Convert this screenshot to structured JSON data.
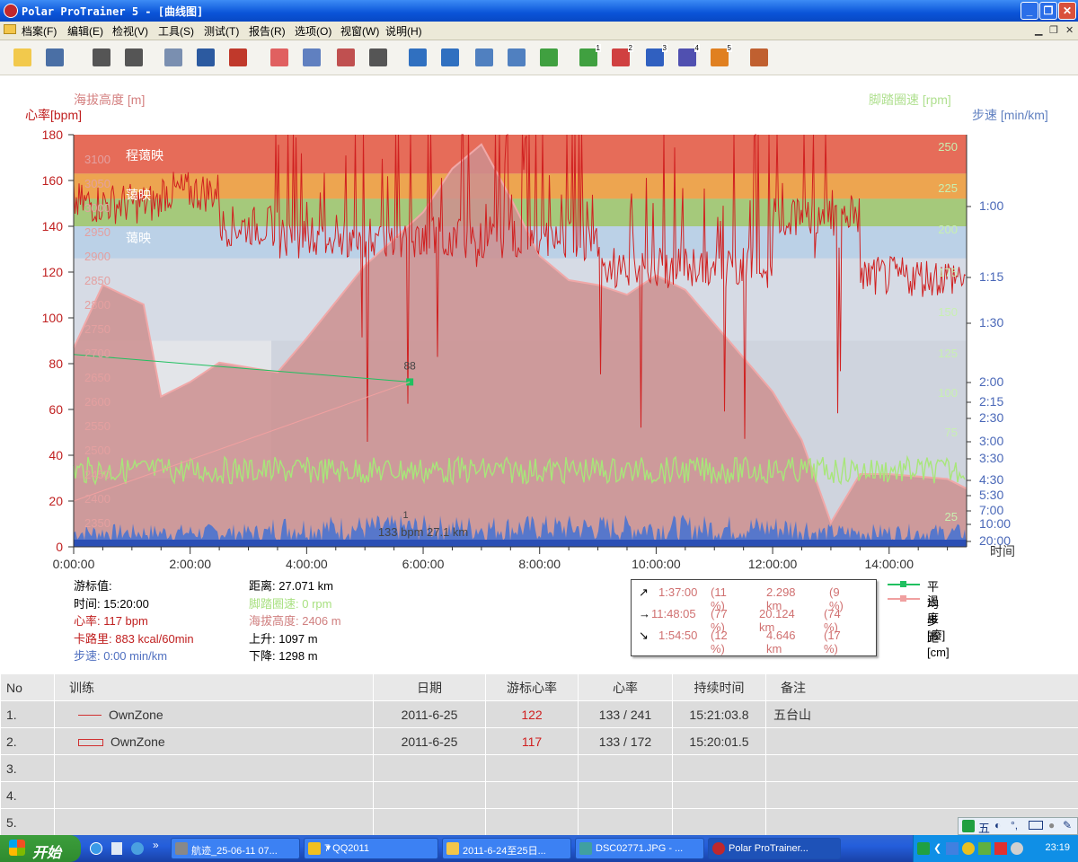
{
  "window": {
    "title": "Polar ProTrainer 5 - [曲线图]",
    "btn_min": "_",
    "btn_restore": "❐",
    "btn_close": "✕"
  },
  "menu": {
    "items": [
      "档案(F)",
      "编辑(E)",
      "检视(V)",
      "工具(S)",
      "测试(T)",
      "报告(R)",
      "选项(O)",
      "视窗(W)",
      "说明(H)"
    ]
  },
  "toolbar": {
    "buttons": [
      {
        "icon": "open-folder-icon",
        "color": "#f2c94c"
      },
      {
        "icon": "save-icon",
        "color": "#4a6fa5"
      },
      {
        "icon": "sync-icon",
        "color": "#555555"
      },
      {
        "icon": "settings-icon",
        "color": "#555555"
      },
      {
        "icon": "calendar-icon",
        "color": "#7a8fb0"
      },
      {
        "icon": "diary-icon",
        "color": "#2c5aa0"
      },
      {
        "icon": "user-icon",
        "color": "#c0392b"
      },
      {
        "icon": "curve-view-icon",
        "color": "#e06060"
      },
      {
        "icon": "bar-view-icon",
        "color": "#6080c0"
      },
      {
        "icon": "percent-view-icon",
        "color": "#c05050"
      },
      {
        "icon": "table-view-icon",
        "color": "#555555"
      },
      {
        "icon": "zoom-icon",
        "color": "#3070c0"
      },
      {
        "icon": "info-chart-icon",
        "color": "#3070c0"
      },
      {
        "icon": "download-icon",
        "color": "#5080c0"
      },
      {
        "icon": "stopwatch-icon",
        "color": "#5080c0"
      },
      {
        "icon": "multi-curve-icon",
        "color": "#40a040"
      },
      {
        "icon": "compare-1-icon",
        "color": "#40a040",
        "num": "1"
      },
      {
        "icon": "compare-2-icon",
        "color": "#d04040",
        "num": "2"
      },
      {
        "icon": "compare-3-icon",
        "color": "#3060c0",
        "num": "3"
      },
      {
        "icon": "compare-4-icon",
        "color": "#5050b0",
        "num": "4"
      },
      {
        "icon": "compare-5-icon",
        "color": "#e08020",
        "num": "5"
      },
      {
        "icon": "people-icon",
        "color": "#c06030"
      }
    ]
  },
  "chart": {
    "left_labels": {
      "hr": "心率[bpm]",
      "alt": "海拔高度 [m]"
    },
    "right_labels": {
      "cadence": "脚踏圈速 [rpm]",
      "pace": "步速 [min/km]"
    },
    "x_unit": "时间",
    "zones": [
      "程蔼映",
      "蔼映",
      "蔼映"
    ],
    "marker_value": "88",
    "center_label": "133 bpm 27.1 km",
    "small_one": "1"
  },
  "chart_data": {
    "type": "line",
    "x": [
      "0:00:00",
      "2:00:00",
      "4:00:00",
      "6:00:00",
      "8:00:00",
      "10:00:00",
      "12:00:00",
      "14:00:00"
    ],
    "yaxis_hr": [
      0,
      20,
      40,
      60,
      80,
      100,
      120,
      140,
      160,
      180
    ],
    "yaxis_alt": [
      2350,
      2400,
      2450,
      2500,
      2550,
      2600,
      2650,
      2700,
      2750,
      2800,
      2850,
      2900,
      2950,
      3000,
      3050,
      3100
    ],
    "yaxis_cadence": [
      25,
      50,
      75,
      100,
      125,
      150,
      175,
      200,
      225,
      250
    ],
    "yaxis_pace": [
      "1:00",
      "1:15",
      "1:30",
      "2:00",
      "2:15",
      "2:30",
      "3:00",
      "3:30",
      "4:30",
      "5:30",
      "7:00",
      "10:00",
      "20:00"
    ],
    "altitude_profile": [
      [
        0,
        2710
      ],
      [
        0.5,
        2840
      ],
      [
        1.2,
        2800
      ],
      [
        1.5,
        2610
      ],
      [
        2,
        2640
      ],
      [
        2.5,
        2680
      ],
      [
        3,
        2670
      ],
      [
        3.5,
        2660
      ],
      [
        4,
        2730
      ],
      [
        5,
        2880
      ],
      [
        6,
        2990
      ],
      [
        6.5,
        3080
      ],
      [
        7,
        3130
      ],
      [
        7.5,
        3020
      ],
      [
        8,
        2900
      ],
      [
        8.5,
        2850
      ],
      [
        9,
        2840
      ],
      [
        9.5,
        2820
      ],
      [
        10,
        2860
      ],
      [
        10.5,
        2830
      ],
      [
        11,
        2760
      ],
      [
        12,
        2620
      ],
      [
        12.5,
        2520
      ],
      [
        13,
        2350
      ],
      [
        13.5,
        2450
      ],
      [
        14,
        2450
      ],
      [
        15,
        2440
      ],
      [
        15.33,
        2420
      ]
    ],
    "xlim_hours": [
      0,
      15.33
    ],
    "hr_ylim": [
      0,
      180
    ],
    "alt_ylim": [
      2300,
      3150
    ]
  },
  "cursor_info": {
    "title": "游标值:",
    "time": "时间: 15:20:00",
    "hr": "心率: 117 bpm",
    "cal": "卡路里: 883 kcal/60min",
    "pace": "步速: 0:00 min/km",
    "dist": "距离: 27.071 km",
    "cadence": "脚踏圈速: 0 rpm",
    "alt": "海拔高度: 2406 m",
    "ascent": "上升: 1097 m",
    "descent": "下降: 1298 m"
  },
  "segments": [
    {
      "arrow": "↗",
      "time": "1:37:00",
      "pct": "(11 %)",
      "dist": "2.298 km",
      "dpct": "(9 %)"
    },
    {
      "arrow": "→",
      "time": "11:48:05",
      "pct": "(77 %)",
      "dist": "20.124 km",
      "dpct": "(74 %)"
    },
    {
      "arrow": "↘",
      "time": "1:54:50",
      "pct": "(12 %)",
      "dist": "4.646 km",
      "dpct": "(17 %)"
    }
  ],
  "legend": {
    "stride": "平均步距 [cm]",
    "temp": "温度 [癈]"
  },
  "table": {
    "headers": [
      "No",
      "训练",
      "日期",
      "游标心率",
      "心率",
      "持续时间",
      "备注"
    ],
    "rows": [
      {
        "no": "1.",
        "name": "OwnZone",
        "date": "2011-6-25",
        "cursor_hr": "122",
        "hr": "133 / 241",
        "dur": "15:21:03.8",
        "note": "五台山"
      },
      {
        "no": "2.",
        "name": "OwnZone",
        "date": "2011-6-25",
        "cursor_hr": "117",
        "hr": "133 / 172",
        "dur": "15:20:01.5",
        "note": ""
      },
      {
        "no": "3.",
        "name": "",
        "date": "",
        "cursor_hr": "",
        "hr": "",
        "dur": "",
        "note": ""
      },
      {
        "no": "4.",
        "name": "",
        "date": "",
        "cursor_hr": "",
        "hr": "",
        "dur": "",
        "note": ""
      },
      {
        "no": "5.",
        "name": "",
        "date": "",
        "cursor_hr": "",
        "hr": "",
        "dur": "",
        "note": ""
      }
    ]
  },
  "taskbar": {
    "start": "开始",
    "tasks": [
      "航迹_25-06-11 07...",
      "7 QQ2011",
      "2011-6-24至25日...",
      "DSC02771.JPG - ...",
      "Polar ProTrainer..."
    ],
    "clock": "23:19",
    "ime": "五"
  },
  "colors": {
    "hr": "#d02020",
    "alt_fill": "#cc8f8f",
    "cadence": "#a8e67a",
    "pace": "#4a73d0",
    "stride": "#20c060",
    "temp": "#f0a0a0",
    "zone_red": "#e8604a",
    "zone_orange": "#f0a040",
    "zone_green": "#a0c870",
    "zone_blue": "#b8d0e8"
  }
}
